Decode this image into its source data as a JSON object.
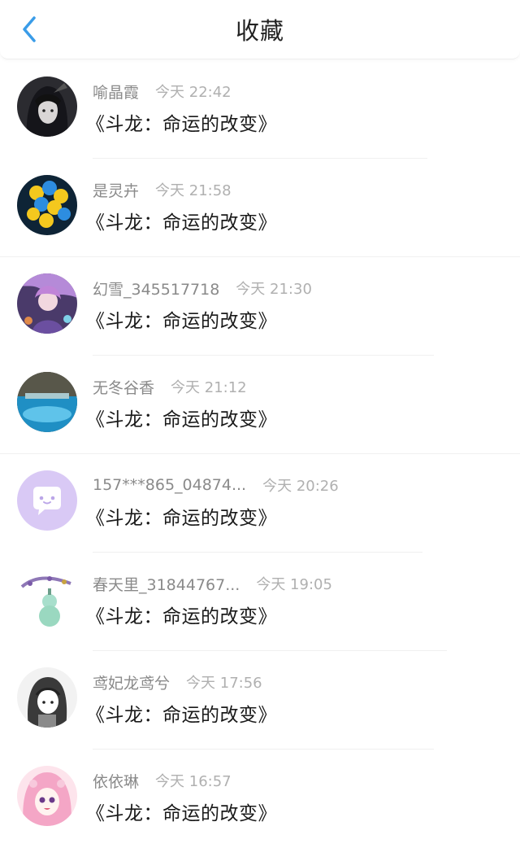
{
  "header": {
    "title": "收藏",
    "back_icon": "chevron-left-icon",
    "accent_color": "#3a9ce8"
  },
  "items": [
    {
      "username": "喻晶霞",
      "time": "今天 22:42",
      "book": "《斗龙：命运的改变》",
      "avatar": "dark-anime-girl"
    },
    {
      "username": "是灵卉",
      "time": "今天 21:58",
      "book": "《斗龙：命运的改变》",
      "avatar": "yellow-blue-balloons"
    },
    {
      "username": "幻雪_345517718",
      "time": "今天 21:30",
      "book": "《斗龙：命运的改变》",
      "avatar": "purple-anime-art"
    },
    {
      "username": "无冬谷香",
      "time": "今天 21:12",
      "book": "《斗龙：命运的改变》",
      "avatar": "blue-pool-scene"
    },
    {
      "username": "157***865_04874...",
      "time": "今天 20:26",
      "book": "《斗龙：命运的改变》",
      "avatar": "default-chat-bubble"
    },
    {
      "username": "春天里_31844767...",
      "time": "今天 19:05",
      "book": "《斗龙：命运的改变》",
      "avatar": "jade-gourd"
    },
    {
      "username": "鸢妃龙鸢兮",
      "time": "今天 17:56",
      "book": "《斗龙：命运的改变》",
      "avatar": "sketch-hooded-girl"
    },
    {
      "username": "依依琳",
      "time": "今天 16:57",
      "book": "《斗龙：命运的改变》",
      "avatar": "pink-anime-girl"
    }
  ]
}
